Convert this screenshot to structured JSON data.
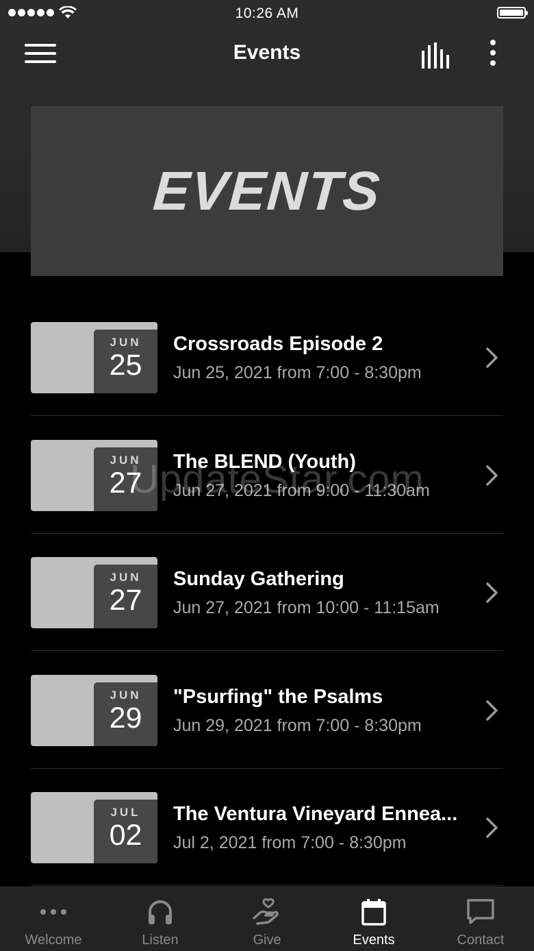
{
  "status_bar": {
    "time": "10:26 AM"
  },
  "nav": {
    "title": "Events"
  },
  "banner": {
    "text": "EVENTS"
  },
  "events": [
    {
      "month": "JUN",
      "day": "25",
      "title": "Crossroads Episode 2",
      "time": "Jun 25, 2021 from 7:00 - 8:30pm"
    },
    {
      "month": "JUN",
      "day": "27",
      "title": "The BLEND (Youth)",
      "time": "Jun 27, 2021 from 9:00 - 11:30am"
    },
    {
      "month": "JUN",
      "day": "27",
      "title": "Sunday Gathering",
      "time": "Jun 27, 2021 from 10:00 - 11:15am"
    },
    {
      "month": "JUN",
      "day": "29",
      "title": "\"Psurfing\" the Psalms",
      "time": "Jun 29, 2021 from 7:00 - 8:30pm"
    },
    {
      "month": "JUL",
      "day": "02",
      "title": "The Ventura Vineyard Ennea...",
      "time": "Jul 2, 2021 from 7:00 - 8:30pm"
    }
  ],
  "watermark": "UpdateStar.com",
  "tabs": [
    {
      "label": "Welcome",
      "icon": "more-horizontal-icon"
    },
    {
      "label": "Listen",
      "icon": "headphones-icon"
    },
    {
      "label": "Give",
      "icon": "hand-heart-icon"
    },
    {
      "label": "Events",
      "icon": "calendar-icon",
      "active": true
    },
    {
      "label": "Contact",
      "icon": "chat-bubble-icon"
    }
  ],
  "colors": {
    "background": "#000000",
    "header": "#2a2a2a",
    "tab_active": "#ffffff",
    "tab_inactive": "#8a8a8a"
  }
}
